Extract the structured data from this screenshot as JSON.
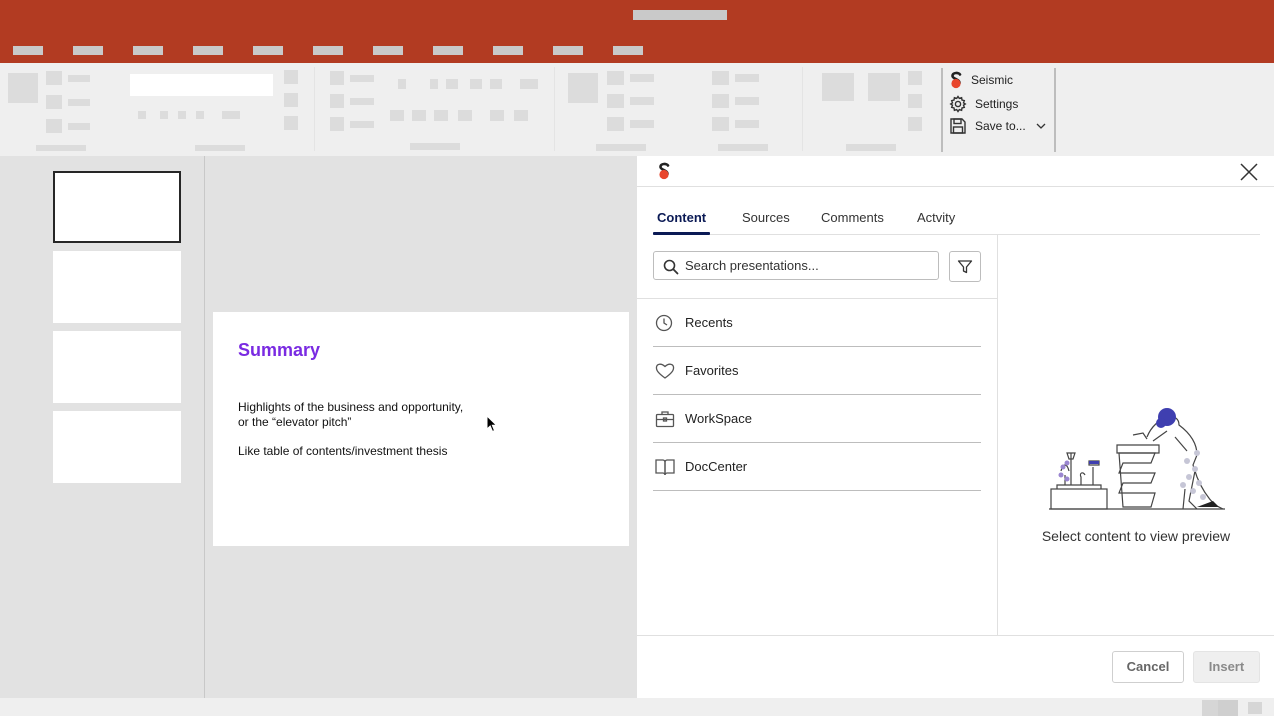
{
  "colors": {
    "titlebar": "#b23b22",
    "tab_active": "#0b1a55",
    "slide_title": "#7a2be2",
    "seismic_logo_top": "#222222",
    "seismic_logo_bottom": "#e8452c"
  },
  "ribbon_addin": {
    "items": [
      {
        "label": "Seismic",
        "icon": "seismic-logo-icon"
      },
      {
        "label": "Settings",
        "icon": "gear-icon"
      },
      {
        "label": "Save to...",
        "icon": "save-icon"
      }
    ]
  },
  "slide": {
    "title": "Summary",
    "line1": "Highlights of the business and opportunity,",
    "line2": "or the “elevator pitch”",
    "line3": "Like table of contents/investment thesis"
  },
  "panel": {
    "tabs": [
      "Content",
      "Sources",
      "Comments",
      "Actvity"
    ],
    "active_tab": "Content",
    "search_placeholder": "Search presentations...",
    "nav_items": [
      {
        "label": "Recents",
        "icon": "clock-icon"
      },
      {
        "label": "Favorites",
        "icon": "heart-icon"
      },
      {
        "label": "WorkSpace",
        "icon": "briefcase-icon"
      },
      {
        "label": "DocCenter",
        "icon": "book-icon"
      }
    ],
    "preview_text": "Select content to view preview",
    "cancel_label": "Cancel",
    "insert_label": "Insert"
  }
}
